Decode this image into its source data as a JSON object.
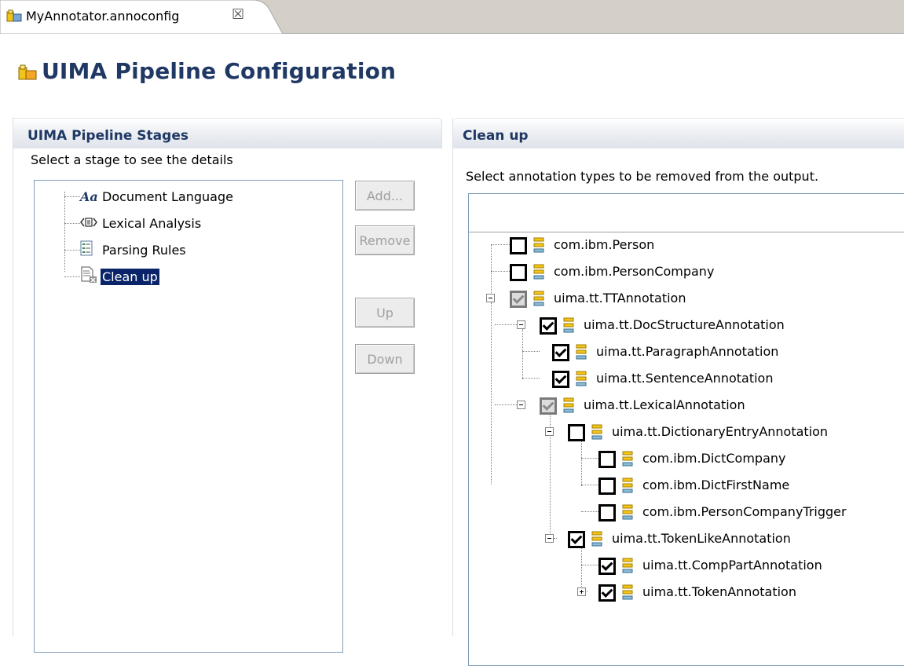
{
  "tab": {
    "title": "MyAnnotator.annoconfig",
    "close_symbol": "☒",
    "icon": "annotator-config-icon"
  },
  "page": {
    "title": "UIMA Pipeline Configuration",
    "icon": "uima-config-icon"
  },
  "stages_section": {
    "title": "UIMA Pipeline Stages",
    "description": "Select a stage to see the details",
    "items": [
      {
        "label": "Document Language",
        "icon": "font-aa-icon",
        "selected": false
      },
      {
        "label": "Lexical Analysis",
        "icon": "lexical-icon",
        "selected": false
      },
      {
        "label": "Parsing Rules",
        "icon": "rules-list-icon",
        "selected": false
      },
      {
        "label": "Clean up",
        "icon": "cleanup-document-icon",
        "selected": true
      }
    ]
  },
  "buttons": {
    "add": "Add...",
    "remove": "Remove",
    "up": "Up",
    "down": "Down"
  },
  "cleanup_section": {
    "title": "Clean up",
    "description": "Select annotation types to be removed from the output.",
    "tree": [
      {
        "label": "com.ibm.Person",
        "state": "unchecked"
      },
      {
        "label": "com.ibm.PersonCompany",
        "state": "unchecked"
      },
      {
        "label": "uima.tt.TTAnnotation",
        "state": "grayed"
      },
      {
        "label": "uima.tt.DocStructureAnnotation",
        "state": "checked"
      },
      {
        "label": "uima.tt.ParagraphAnnotation",
        "state": "checked"
      },
      {
        "label": "uima.tt.SentenceAnnotation",
        "state": "checked"
      },
      {
        "label": "uima.tt.LexicalAnnotation",
        "state": "grayed"
      },
      {
        "label": "uima.tt.DictionaryEntryAnnotation",
        "state": "unchecked"
      },
      {
        "label": "com.ibm.DictCompany",
        "state": "unchecked"
      },
      {
        "label": "com.ibm.DictFirstName",
        "state": "unchecked"
      },
      {
        "label": "com.ibm.PersonCompanyTrigger",
        "state": "unchecked"
      },
      {
        "label": "uima.tt.TokenLikeAnnotation",
        "state": "checked"
      },
      {
        "label": "uima.tt.CompPartAnnotation",
        "state": "checked"
      },
      {
        "label": "uima.tt.TokenAnnotation",
        "state": "checked"
      }
    ]
  },
  "colors": {
    "title_blue": "#1f3864",
    "selection": "#0a246a",
    "tab_bg": "#d4d0c8",
    "list_border": "#7f9db9"
  }
}
